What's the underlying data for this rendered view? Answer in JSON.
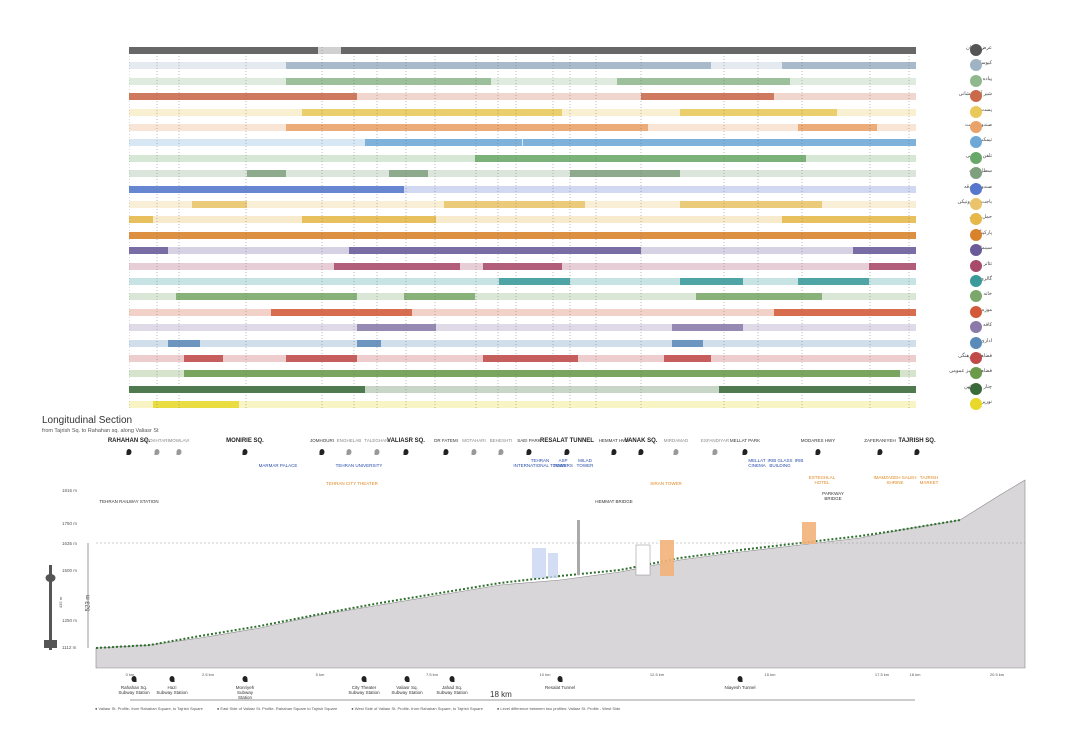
{
  "legend": [
    {
      "label": "عرض خیابان",
      "color": "#555555",
      "icon": "road-icon"
    },
    {
      "label": "کیوسک",
      "color": "#9fb3c4",
      "icon": "kiosk-icon"
    },
    {
      "label": "پیاده",
      "color": "#8fb88f",
      "icon": "pedestrian-icon"
    },
    {
      "label": "شیر آتش نشانی",
      "color": "#c96a4a",
      "icon": "fire-hydrant-icon"
    },
    {
      "label": "پست برق",
      "color": "#e8c95a",
      "icon": "electric-icon"
    },
    {
      "label": "صندوق پست",
      "color": "#e9a26a",
      "icon": "mailbox-icon"
    },
    {
      "label": "تیمکت",
      "color": "#6fa8d6",
      "icon": "bench-icon"
    },
    {
      "label": "تلفن عمومی",
      "color": "#6aa86a",
      "icon": "phone-icon"
    },
    {
      "label": "سطل زباله",
      "color": "#7fa07f",
      "icon": "trash-icon"
    },
    {
      "label": "صندوق صدقه",
      "color": "#5577cc",
      "icon": "charity-box-icon"
    },
    {
      "label": "باجت الکترونیکی",
      "color": "#e9c46a",
      "icon": "atm-icon"
    },
    {
      "label": "حمل و نقل",
      "color": "#e6b84a",
      "icon": "transport-icon"
    },
    {
      "label": "پارکینگ",
      "color": "#d9822b",
      "icon": "parking-icon"
    },
    {
      "label": "سینما",
      "color": "#6a5a9a",
      "icon": "cinema-icon"
    },
    {
      "label": "تئاتر",
      "color": "#a84a6a",
      "icon": "theater-icon"
    },
    {
      "label": "گالری",
      "color": "#3a9a9a",
      "icon": "gallery-icon"
    },
    {
      "label": "خانه",
      "color": "#7aa86a",
      "icon": "house-icon"
    },
    {
      "label": "موزه",
      "color": "#d25a3a",
      "icon": "museum-icon"
    },
    {
      "label": "کافه",
      "color": "#8a7aaa",
      "icon": "cafe-icon"
    },
    {
      "label": "اداری",
      "color": "#5a8ab8",
      "icon": "office-icon"
    },
    {
      "label": "فضاهای فرهنگی",
      "color": "#c04a4a",
      "icon": "culture-icon"
    },
    {
      "label": "فضاهای سبز عمومی",
      "color": "#6a9a4a",
      "icon": "green-space-icon"
    },
    {
      "label": "چنار های کهن",
      "color": "#3a6a3a",
      "icon": "tree-icon"
    },
    {
      "label": "نورپردازی",
      "color": "#e8d82a",
      "icon": "light-icon"
    }
  ],
  "title": "Longitudinal Section",
  "subtitle": "from Tajrish Sq. to Rahahan sq. along Valiasr St",
  "stations": [
    {
      "label": "RAHAHAN SQ.",
      "cls": "major"
    },
    {
      "label": "MOKHTARI",
      "cls": "minor"
    },
    {
      "label": "MOWLAVI",
      "cls": "minor"
    },
    {
      "label": "MONIRIE SQ.",
      "cls": "major"
    },
    {
      "label": "JOMHOURI",
      "cls": "normal"
    },
    {
      "label": "ENGHELAB",
      "cls": "minor"
    },
    {
      "label": "TALEGHANI",
      "cls": "minor"
    },
    {
      "label": "VALIASR SQ.",
      "cls": "major"
    },
    {
      "label": "DR FATEMI",
      "cls": "normal"
    },
    {
      "label": "MOTAHARI",
      "cls": "minor"
    },
    {
      "label": "BEHESHTI",
      "cls": "minor"
    },
    {
      "label": "SAEI PARK",
      "cls": "normal"
    },
    {
      "label": "RESALAT TUNNEL",
      "cls": "major"
    },
    {
      "label": "HEMMAT HWY",
      "cls": "normal"
    },
    {
      "label": "VANAK SQ.",
      "cls": "major"
    },
    {
      "label": "MIRDAMAD",
      "cls": "minor"
    },
    {
      "label": "ESFANDIYAR",
      "cls": "minor"
    },
    {
      "label": "MELLAT PARK",
      "cls": "normal"
    },
    {
      "label": "MODARES HWY",
      "cls": "normal"
    },
    {
      "label": "ZAFERANIYEH",
      "cls": "normal"
    },
    {
      "label": "TAJRISH SQ.",
      "cls": "major"
    }
  ],
  "landmarks": [
    {
      "label": "MARMAR PALACE",
      "cls": "blue"
    },
    {
      "label": "TEHRAN UNIVERSITY",
      "cls": "blue"
    },
    {
      "label": "TEHRAN CITY THEATER",
      "cls": "orange"
    },
    {
      "label": "TEHRAN\nINTERNATIONAL TOWER",
      "cls": "blue"
    },
    {
      "label": "ASP\nTOWERS",
      "cls": "blue"
    },
    {
      "label": "MILAD\nTOWER",
      "cls": "blue"
    },
    {
      "label": "HEMMAT BRIDGE",
      "cls": "normal"
    },
    {
      "label": "SIRAN TOWER",
      "cls": "orange"
    },
    {
      "label": "MELLAT\nCINEMA",
      "cls": "blue"
    },
    {
      "label": "IRIB GLASS\nBUILDING",
      "cls": "blue"
    },
    {
      "label": "IRIB",
      "cls": "blue"
    },
    {
      "label": "ESTEGHLAL\nHOTEL",
      "cls": "orange"
    },
    {
      "label": "PARKWAY\nBRIDGE",
      "cls": "normal"
    },
    {
      "label": "IMAMZADEH SALEH\nSHRINE",
      "cls": "orange"
    },
    {
      "label": "TAJRISH\nMARKET",
      "cls": "orange"
    },
    {
      "label": "TEHRAN RAILWAY STATION",
      "cls": "normal"
    }
  ],
  "subway": [
    "Rahahan Sq.\nSubway Station",
    "Hazi\nSubway Station",
    "Monriyeh\nSubway\nStation",
    "City Theater\nSubway Station",
    "Valiasr Sq.\nSubway Station",
    "Jahad Sq.\nSubway Station",
    "Resalat Tunnel",
    "Niayesh Tunnel"
  ],
  "km_labels": [
    "0 km",
    "2.5 km",
    "5 km",
    "7.5 km",
    "10 km",
    "12.5 km",
    "15 km",
    "17.5 km",
    "18 km",
    "20.5 km"
  ],
  "elevations": [
    "1816 m",
    "1750 m",
    "1635 m",
    "1500 m",
    "1250 m",
    "1112 m"
  ],
  "height_labels": {
    "section": "523 m",
    "tower": "435 m"
  },
  "distance": "18 km",
  "footer": [
    "● Valiasr St. Profile- from Rahahan Square, to Tajrish Square",
    "● East Side of Valiasr St. Profile- Rahahan Square to Tajrish Square",
    "● West Side of Valiasr St. Profile- from Rahahan Square, to Tajrish Square",
    "● Level difference between two profiles: Valiasr St. Profile - West Side"
  ]
}
